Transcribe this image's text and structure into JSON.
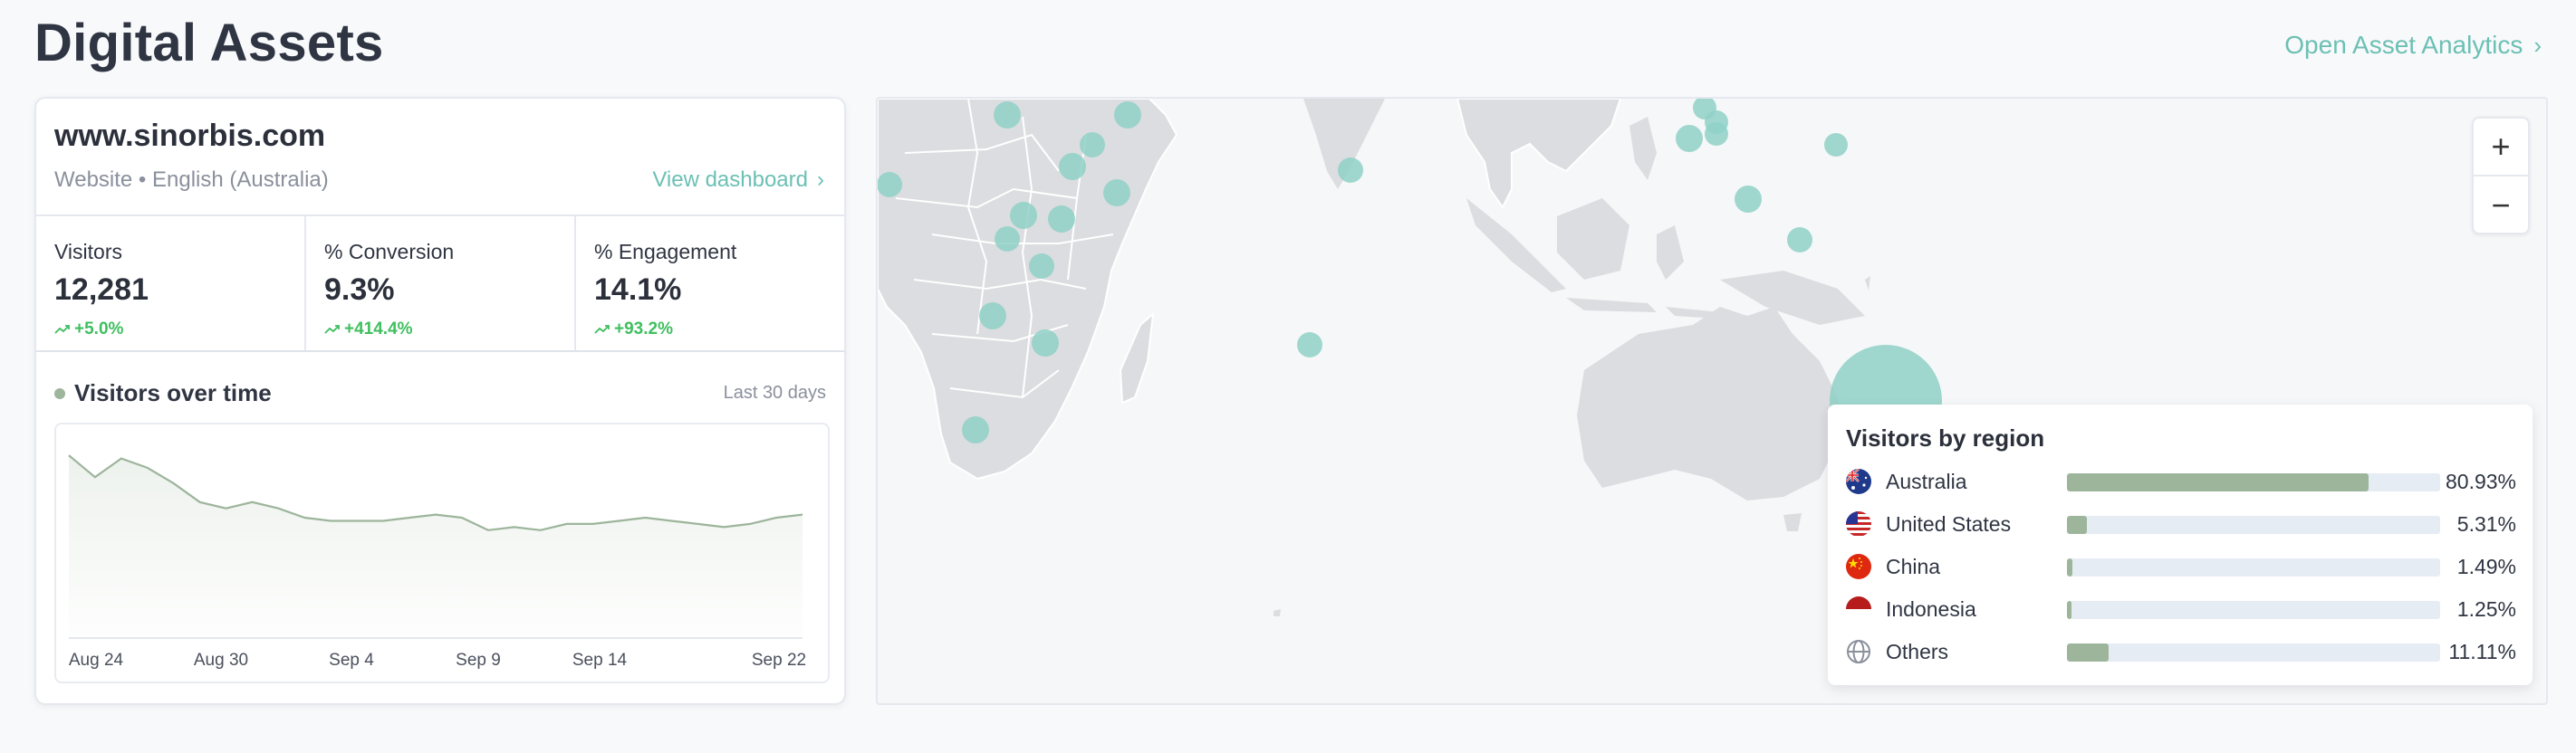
{
  "page": {
    "title": "Digital Assets",
    "top_link": "Open Asset Analytics"
  },
  "site": {
    "name": "www.sinorbis.com",
    "subtitle": "Website • English (Australia)",
    "view_dashboard": "View dashboard"
  },
  "metrics": [
    {
      "label": "Visitors",
      "value": "12,281",
      "delta": "+5.0%"
    },
    {
      "label": "% Conversion",
      "value": "9.3%",
      "delta": "+414.4%"
    },
    {
      "label": "% Engagement",
      "value": "14.1%",
      "delta": "+93.2%"
    }
  ],
  "visitors_over_time": {
    "title": "Visitors over time",
    "range": "Last 30 days",
    "accent": "#9db59b"
  },
  "chart_data": {
    "type": "area",
    "title": "Visitors over time",
    "x_ticks": [
      "Aug 24",
      "Aug 30",
      "Sep 4",
      "Sep 9",
      "Sep 14",
      "Sep 22"
    ],
    "series": [
      {
        "values": [
          58,
          51,
          57,
          54,
          49,
          43,
          41,
          43,
          41,
          38,
          37,
          37,
          37,
          38,
          39,
          38,
          34,
          35,
          34,
          36,
          36,
          37,
          38,
          37,
          36,
          35,
          36,
          38,
          39
        ]
      }
    ],
    "ylim": [
      0,
      65
    ],
    "grid": false
  },
  "map": {
    "zoom_in": "+",
    "zoom_out": "−",
    "bubble_color": "#8fd1c7",
    "land_color": "#dcdde0"
  },
  "region": {
    "title": "Visitors by region",
    "items": [
      {
        "name": "Australia",
        "pct": "80.93%",
        "share": 0.8093,
        "icon": "australia-flag-icon"
      },
      {
        "name": "United States",
        "pct": "5.31%",
        "share": 0.0531,
        "icon": "usa-flag-icon"
      },
      {
        "name": "China",
        "pct": "1.49%",
        "share": 0.0149,
        "icon": "china-flag-icon"
      },
      {
        "name": "Indonesia",
        "pct": "1.25%",
        "share": 0.0125,
        "icon": "indonesia-flag-icon"
      },
      {
        "name": "Others",
        "pct": "11.11%",
        "share": 0.1111,
        "icon": "globe-icon"
      }
    ]
  }
}
